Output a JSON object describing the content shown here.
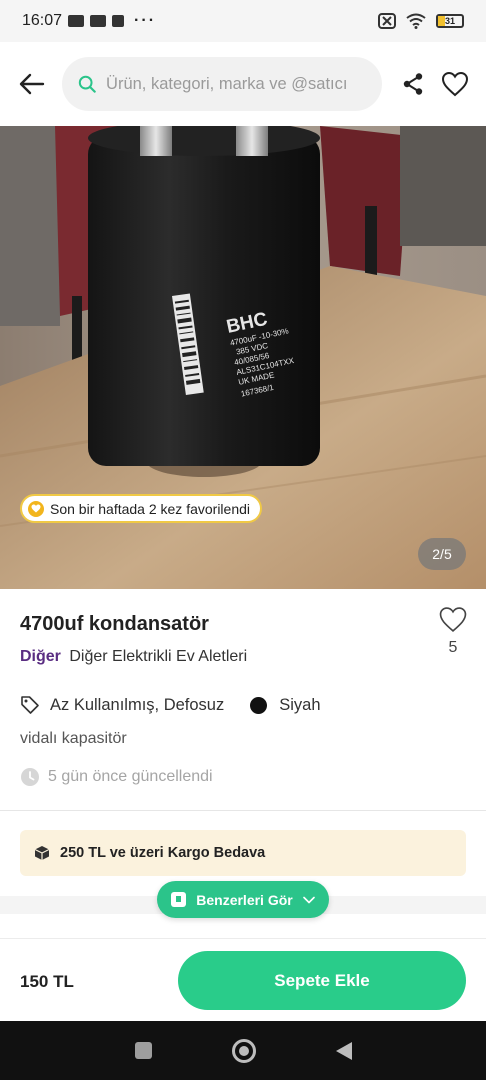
{
  "status_bar": {
    "time": "16:07",
    "dots": "···",
    "battery": "31"
  },
  "search": {
    "placeholder": "Ürün, kategori, marka ve @satıcı"
  },
  "icons": {
    "back": "arrow-left-icon",
    "search": "search-icon",
    "share": "share-icon",
    "favorite": "heart-icon",
    "tag": "tag-icon",
    "clock": "clock-icon",
    "box": "package-icon"
  },
  "image": {
    "capacitor_brand": "BHC",
    "capacitor_text": [
      "4700uF -10-30%",
      "385 VDC",
      "40/085/56",
      "ALS31C104TXX",
      "UK MADE",
      "167368/1"
    ],
    "favorite_badge": "Son bir haftada 2 kez favorilendi",
    "page_indicator": "2/5"
  },
  "product": {
    "title": "4700uf kondansatör",
    "like_count": "5",
    "brand": "Diğer",
    "category": "Diğer Elektrikli Ev Aletleri",
    "condition": "Az Kullanılmış, Defosuz",
    "color_name": "Siyah",
    "description": "vidalı kapasitör",
    "updated": "5 gün önce güncellendi"
  },
  "shipping": {
    "text": "250 TL ve üzeri Kargo Bedava"
  },
  "similar_button": {
    "label": "Benzerleri Gör"
  },
  "buy_bar": {
    "price": "150 TL",
    "cart_label": "Sepete Ekle"
  },
  "colors": {
    "accent_green": "#29cc8a",
    "brand_purple": "#5a2d82",
    "badge_yellow": "#f0c945",
    "shipping_bg": "#fbf2dd"
  }
}
